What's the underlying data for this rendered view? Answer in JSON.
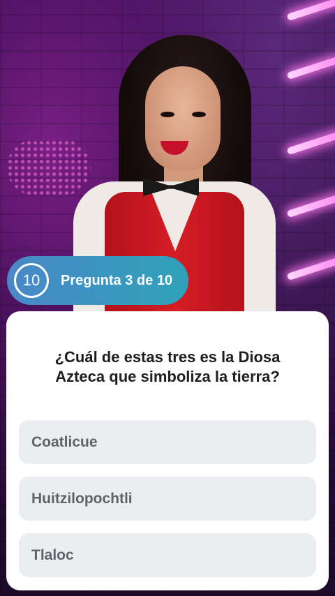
{
  "timer": {
    "value": "10"
  },
  "progress": {
    "label": "Pregunta 3 de 10"
  },
  "question": {
    "text": "¿Cuál de estas tres es la Diosa Azteca que simboliza la tierra?"
  },
  "options": [
    {
      "label": "Coatlicue"
    },
    {
      "label": "Huitzilopochtli"
    },
    {
      "label": "Tlaloc"
    }
  ],
  "colors": {
    "badge_gradient_start": "#4a88c8",
    "badge_gradient_end": "#2fa2b8",
    "option_background": "#ebedf0",
    "option_text": "#5f6368",
    "question_text": "#1e1e1e"
  }
}
